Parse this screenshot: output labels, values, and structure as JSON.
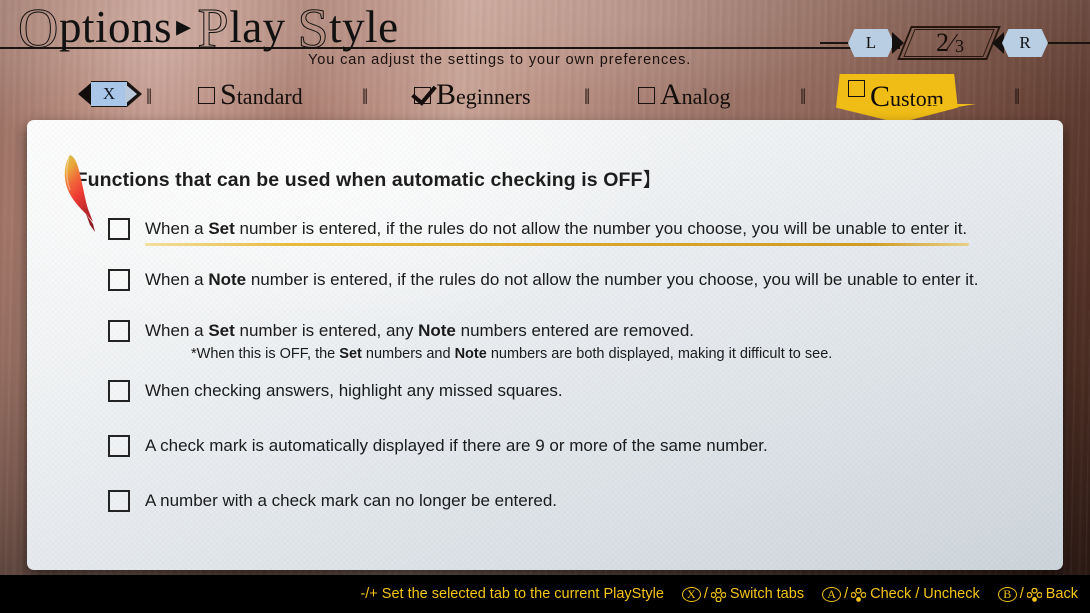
{
  "header": {
    "title_first_cap": "O",
    "title_first_rest": "ptions",
    "title_arrow": "▸",
    "title_second_cap": "P",
    "title_second_rest": "lay ",
    "title_third_cap": "S",
    "title_third_rest": "tyle",
    "subtitle": "You can adjust the settings to your own preferences.",
    "pager": {
      "left_bumper": "L",
      "right_bumper": "R",
      "current_page": "2",
      "separator": "⁄",
      "total_pages": "3"
    }
  },
  "tabbar": {
    "x_button": "X",
    "separator": "‖",
    "tabs": [
      {
        "label_cap": "S",
        "label_rest": "tandard",
        "checked": false,
        "active": false
      },
      {
        "label_cap": "B",
        "label_rest": "eginners",
        "checked": true,
        "active": false
      },
      {
        "label_cap": "A",
        "label_rest": "nalog",
        "checked": false,
        "active": false
      },
      {
        "label_cap": "C",
        "label_rest": "ustom",
        "checked": false,
        "active": true
      }
    ]
  },
  "content": {
    "section_heading_open": "【",
    "section_heading": "Functions that can be used when automatic checking is OFF",
    "section_heading_close": "】",
    "options": [
      {
        "pre": "When a ",
        "bold1": "Set",
        "mid": " number is entered, if the rules do not allow the number you choose, you will be unable to enter it.",
        "checked": false,
        "selected": true,
        "subnote": ""
      },
      {
        "pre": "When a ",
        "bold1": "Note",
        "mid": " number is entered, if the rules do not allow the number you choose, you will be unable to enter it.",
        "checked": false,
        "selected": false,
        "subnote": ""
      },
      {
        "pre": "When a ",
        "bold1": "Set",
        "mid": " number is entered, any ",
        "bold2": "Note",
        "post": " numbers entered are removed.",
        "checked": false,
        "selected": false,
        "subnote_pre": "*When this is OFF, the ",
        "subnote_bold1": "Set",
        "subnote_mid": " numbers and ",
        "subnote_bold2": "Note",
        "subnote_post": " numbers are both displayed, making it difficult to see."
      },
      {
        "pre": "When checking answers, highlight any missed squares.",
        "checked": false,
        "selected": false,
        "subnote": ""
      },
      {
        "pre": "A check mark is automatically displayed if there are 9 or more of the same number.",
        "checked": false,
        "selected": false,
        "subnote": ""
      },
      {
        "pre": "A number with a check mark can no longer be entered.",
        "checked": false,
        "selected": false,
        "subnote": ""
      }
    ]
  },
  "footer": {
    "hints": [
      {
        "glyph": "",
        "keys": "-/+",
        "label": "Set the selected tab to the current PlayStyle"
      },
      {
        "glyph": "X",
        "label": "Switch tabs"
      },
      {
        "glyph": "A",
        "label": "Check / Uncheck"
      },
      {
        "glyph": "B",
        "label": "Back"
      }
    ]
  },
  "colors": {
    "accent_yellow": "#f0bd16",
    "footer_text": "#f5c518",
    "highlight_underline": "#d9a52a",
    "tab_button_blue": "#a9c6e8"
  }
}
